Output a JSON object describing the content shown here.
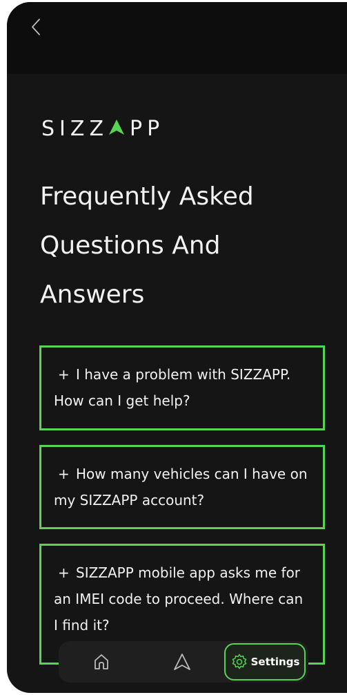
{
  "header": {
    "back_icon": "chevron-left-icon"
  },
  "brand": {
    "logo_prefix": "SIZZ",
    "logo_suffix": "PP",
    "accent_color": "#57d453"
  },
  "page": {
    "title": "Frequently Asked Questions And Answers"
  },
  "faq": {
    "items": [
      {
        "icon": "+",
        "question": "I have a problem with SIZZAPP. How can I get help?"
      },
      {
        "icon": "+",
        "question": "How many vehicles can I have on my SIZZAPP account?"
      },
      {
        "icon": "+",
        "question": "SIZZAPP mobile app asks me for an IMEI code to proceed. Where can I find it?"
      }
    ]
  },
  "bottom_nav": {
    "home_icon": "home-icon",
    "navigate_icon": "navigation-arrow-icon",
    "settings_icon": "gear-icon",
    "settings_label": "Settings"
  }
}
